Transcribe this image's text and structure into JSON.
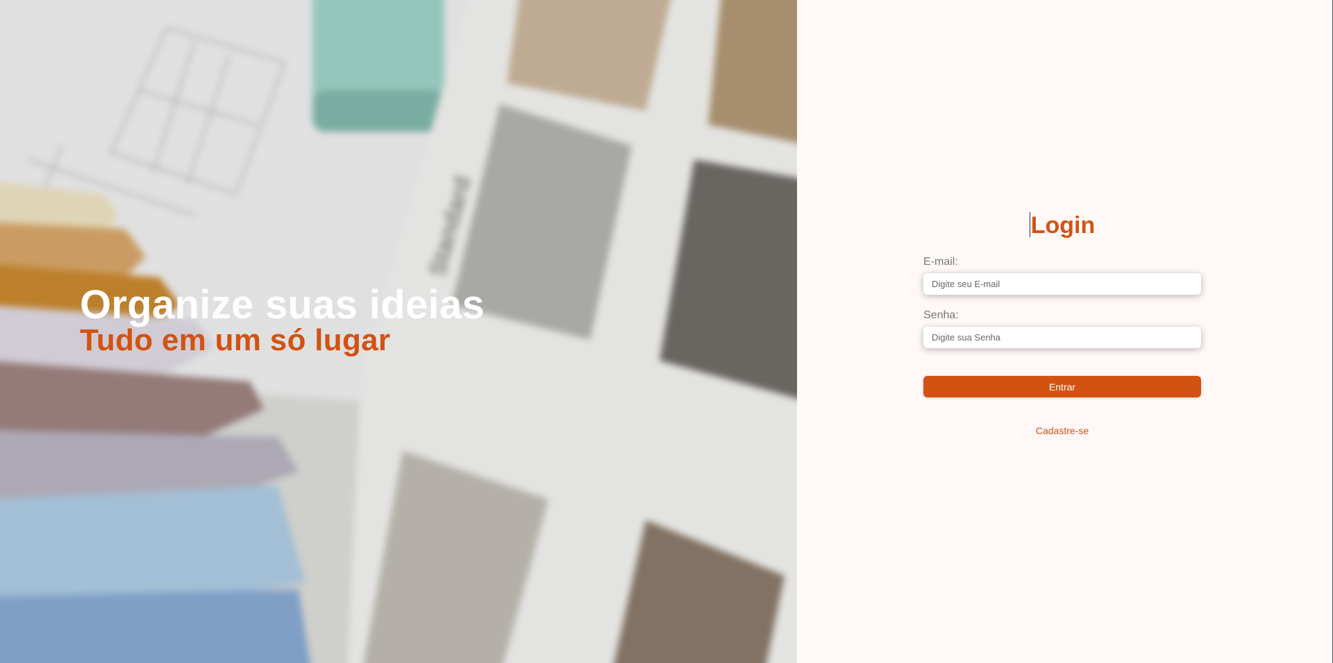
{
  "hero": {
    "title": "Organize suas ideias",
    "subtitle": "Tudo em um só lugar"
  },
  "login": {
    "title": "Login",
    "email_label": "E-mail:",
    "email_placeholder": "Digite seu E-mail",
    "email_value": "",
    "password_label": "Senha:",
    "password_placeholder": "Digite sua Senha",
    "password_value": "",
    "submit_label": "Entrar",
    "signup_label": "Cadastre-se"
  },
  "colors": {
    "accent": "#d35212",
    "panel_background": "#fff8f7",
    "hero_title": "#ffffff"
  }
}
